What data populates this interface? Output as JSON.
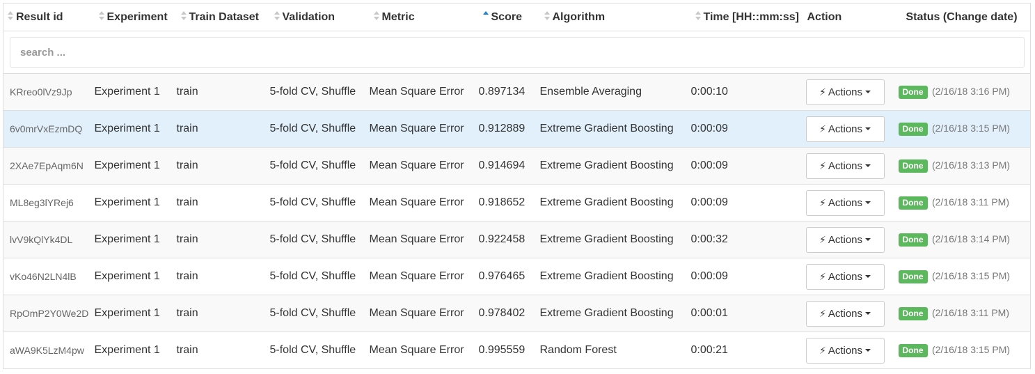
{
  "table": {
    "columns": [
      {
        "key": "result_id",
        "label": "Result id",
        "sortable": true,
        "sorted": false
      },
      {
        "key": "experiment",
        "label": "Experiment",
        "sortable": true,
        "sorted": false
      },
      {
        "key": "train_dataset",
        "label": "Train Dataset",
        "sortable": true,
        "sorted": false
      },
      {
        "key": "validation",
        "label": "Validation",
        "sortable": true,
        "sorted": false
      },
      {
        "key": "metric",
        "label": "Metric",
        "sortable": true,
        "sorted": false
      },
      {
        "key": "score",
        "label": "Score",
        "sortable": true,
        "sorted": "asc"
      },
      {
        "key": "algorithm",
        "label": "Algorithm",
        "sortable": true,
        "sorted": false
      },
      {
        "key": "time",
        "label": "Time [HH::mm:ss]",
        "sortable": true,
        "sorted": false
      },
      {
        "key": "action",
        "label": "Action",
        "sortable": false,
        "sorted": false
      },
      {
        "key": "status",
        "label": "Status (Change date)",
        "sortable": false,
        "sorted": false
      }
    ],
    "search": {
      "placeholder": "search ...",
      "value": ""
    },
    "rows": [
      {
        "result_id": "KRreo0lVz9Jp",
        "experiment": "Experiment 1",
        "train_dataset": "train",
        "validation": "5-fold CV, Shuffle",
        "metric": "Mean Square Error",
        "score": "0.897134",
        "algorithm": "Ensemble Averaging",
        "time": "0:00:10",
        "action_label": "Actions",
        "status": "Done",
        "change_date": "(2/16/18 3:16 PM)"
      },
      {
        "result_id": "6v0mrVxEzmDQ",
        "experiment": "Experiment 1",
        "train_dataset": "train",
        "validation": "5-fold CV, Shuffle",
        "metric": "Mean Square Error",
        "score": "0.912889",
        "algorithm": "Extreme Gradient Boosting",
        "time": "0:00:09",
        "action_label": "Actions",
        "status": "Done",
        "change_date": "(2/16/18 3:15 PM)"
      },
      {
        "result_id": "2XAe7EpAqm6N",
        "experiment": "Experiment 1",
        "train_dataset": "train",
        "validation": "5-fold CV, Shuffle",
        "metric": "Mean Square Error",
        "score": "0.914694",
        "algorithm": "Extreme Gradient Boosting",
        "time": "0:00:09",
        "action_label": "Actions",
        "status": "Done",
        "change_date": "(2/16/18 3:13 PM)"
      },
      {
        "result_id": "ML8eg3lYRej6",
        "experiment": "Experiment 1",
        "train_dataset": "train",
        "validation": "5-fold CV, Shuffle",
        "metric": "Mean Square Error",
        "score": "0.918652",
        "algorithm": "Extreme Gradient Boosting",
        "time": "0:00:09",
        "action_label": "Actions",
        "status": "Done",
        "change_date": "(2/16/18 3:11 PM)"
      },
      {
        "result_id": "lvV9kQlYk4DL",
        "experiment": "Experiment 1",
        "train_dataset": "train",
        "validation": "5-fold CV, Shuffle",
        "metric": "Mean Square Error",
        "score": "0.922458",
        "algorithm": "Extreme Gradient Boosting",
        "time": "0:00:32",
        "action_label": "Actions",
        "status": "Done",
        "change_date": "(2/16/18 3:14 PM)"
      },
      {
        "result_id": "vKo46N2LN4lB",
        "experiment": "Experiment 1",
        "train_dataset": "train",
        "validation": "5-fold CV, Shuffle",
        "metric": "Mean Square Error",
        "score": "0.976465",
        "algorithm": "Extreme Gradient Boosting",
        "time": "0:00:09",
        "action_label": "Actions",
        "status": "Done",
        "change_date": "(2/16/18 3:15 PM)"
      },
      {
        "result_id": "RpOmP2Y0We2D",
        "experiment": "Experiment 1",
        "train_dataset": "train",
        "validation": "5-fold CV, Shuffle",
        "metric": "Mean Square Error",
        "score": "0.978402",
        "algorithm": "Extreme Gradient Boosting",
        "time": "0:00:01",
        "action_label": "Actions",
        "status": "Done",
        "change_date": "(2/16/18 3:11 PM)"
      },
      {
        "result_id": "aWA9K5LzM4pw",
        "experiment": "Experiment 1",
        "train_dataset": "train",
        "validation": "5-fold CV, Shuffle",
        "metric": "Mean Square Error",
        "score": "0.995559",
        "algorithm": "Random Forest",
        "time": "0:00:21",
        "action_label": "Actions",
        "status": "Done",
        "change_date": "(2/16/18 3:15 PM)"
      }
    ],
    "highlighted_row": 1
  },
  "colors": {
    "status_done": "#5cb85c",
    "row_highlight": "#e1f0fb",
    "sort_active": "#1a7fd6",
    "border": "#dddddd"
  },
  "icons": {
    "action_button_icon": "bolt-icon",
    "dropdown_icon": "caret-down-icon",
    "sort_icon": "sort-icon"
  }
}
